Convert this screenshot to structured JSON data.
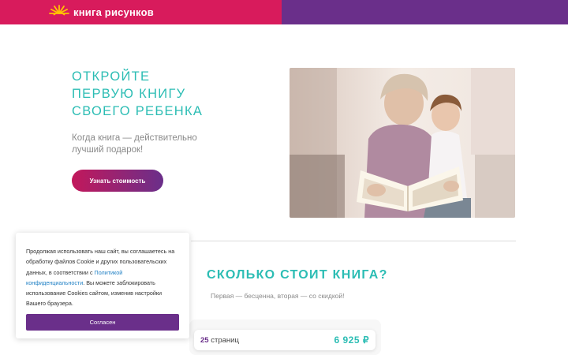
{
  "header": {
    "logo_text": "книга рисунков",
    "colors": {
      "left": "#d81b5c",
      "right": "#6a2f8a"
    }
  },
  "hero": {
    "title_lines": [
      "Откройте",
      "первую книгу",
      "своего ребенка"
    ],
    "subtitle": "Когда книга — действительно лучший подарок!",
    "cta_label": "Узнать стоимость",
    "photo_icon": "mother-daughter-reading-photo"
  },
  "pricing": {
    "title": "Сколько стоит книга?",
    "subtitle": "Первая — бесценна, вторая — со скидкой!",
    "option": {
      "pages_count": "25",
      "pages_label": "страниц",
      "price": "6 925 ₽"
    }
  },
  "cookie": {
    "text_before_link": "Продолжая использовать наш сайт, вы соглашаетесь на обработку файлов Cookie и других пользовательских данных, в соответствии с ",
    "link_text": "Политикой конфиденциальности",
    "text_after_link": ". Вы можете заблокировать использование Cookies сайтом, изменив настройки Вашего браузера.",
    "accept_label": "Согласен"
  },
  "colors": {
    "accent_teal": "#2cbdb4",
    "brand_purple": "#6a2f8a",
    "brand_pink": "#d81b5c"
  }
}
